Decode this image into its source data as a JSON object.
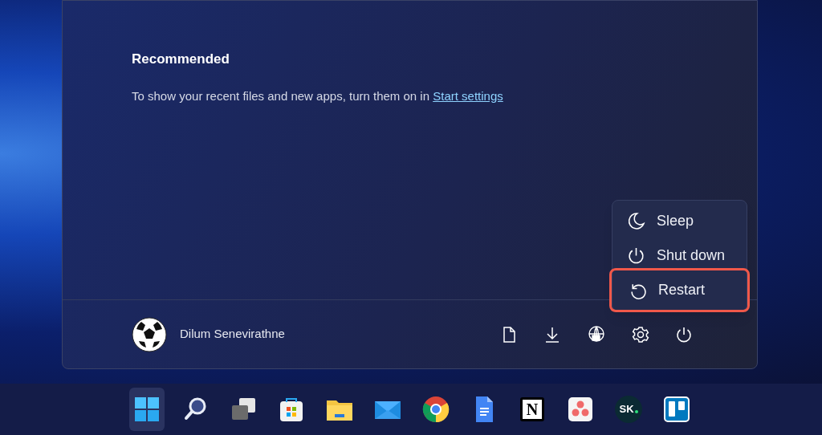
{
  "start_menu": {
    "recommended": {
      "title": "Recommended",
      "message": "To show your recent files and new apps, turn them on in ",
      "link": "Start settings"
    },
    "power_menu": [
      {
        "kind": "sleep",
        "label": "Sleep",
        "highlighted": false
      },
      {
        "kind": "shutdown",
        "label": "Shut down",
        "highlighted": false
      },
      {
        "kind": "restart",
        "label": "Restart",
        "highlighted": true
      }
    ],
    "user": {
      "name": "Dilum Senevirathne"
    }
  },
  "taskbar": [
    {
      "kind": "start",
      "selected": true
    },
    {
      "kind": "search",
      "selected": false
    },
    {
      "kind": "taskview",
      "selected": false
    },
    {
      "kind": "store",
      "selected": false
    },
    {
      "kind": "explorer",
      "selected": false
    },
    {
      "kind": "mail",
      "selected": false
    },
    {
      "kind": "chrome",
      "selected": false
    },
    {
      "kind": "docs",
      "selected": false
    },
    {
      "kind": "notion",
      "label": "N",
      "selected": false
    },
    {
      "kind": "asana",
      "selected": false
    },
    {
      "kind": "sk",
      "label": "SK",
      "selected": false
    },
    {
      "kind": "trello",
      "selected": false
    }
  ]
}
